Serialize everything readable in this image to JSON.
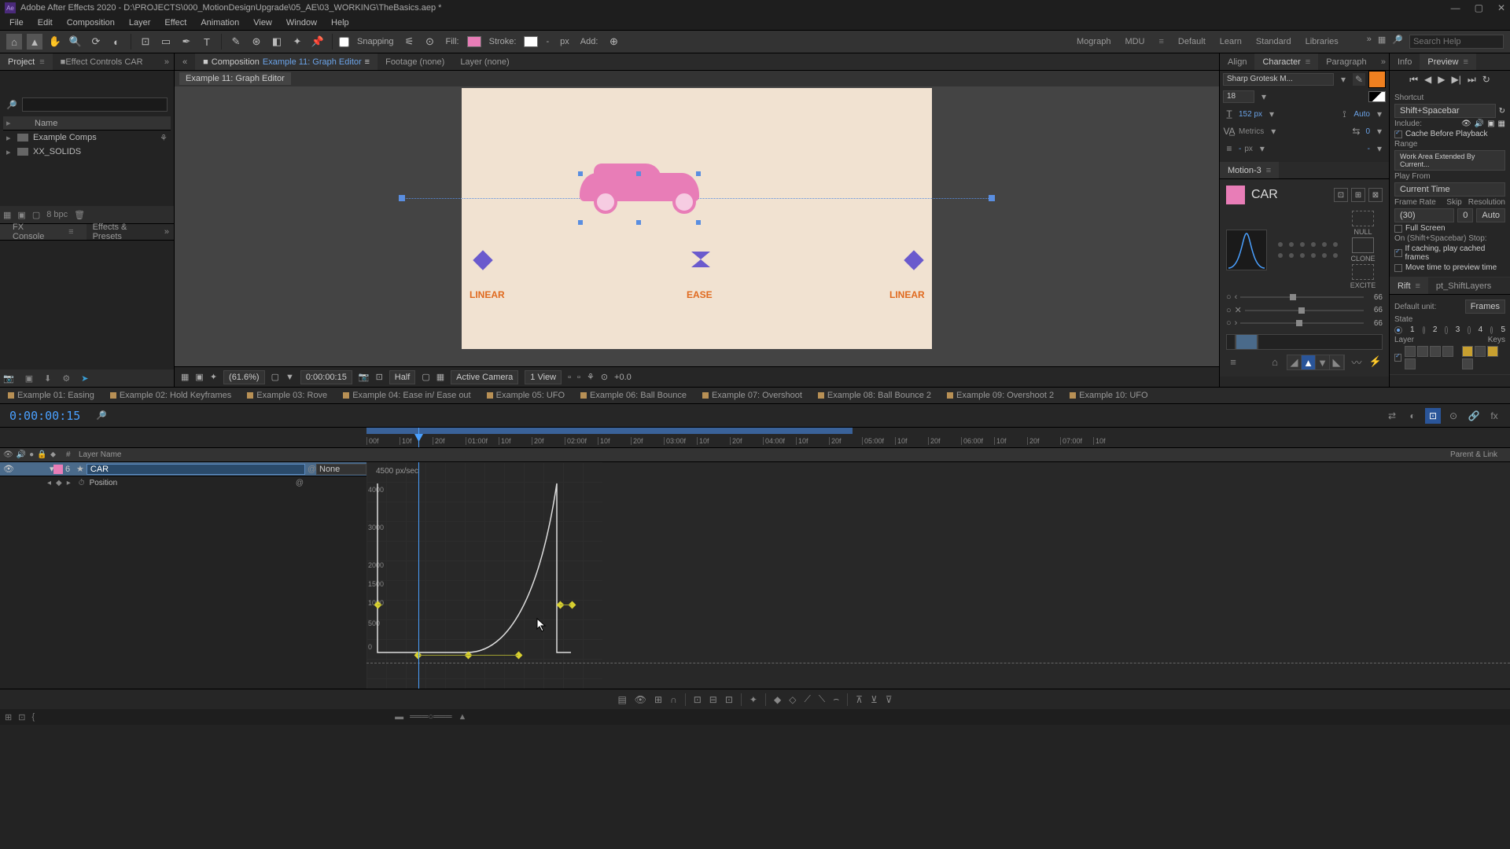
{
  "titlebar": {
    "app": "Adobe After Effects 2020",
    "path": "D:\\PROJECTS\\000_MotionDesignUpgrade\\05_AE\\03_WORKING\\TheBasics.aep *"
  },
  "menus": [
    "File",
    "Edit",
    "Composition",
    "Layer",
    "Effect",
    "Animation",
    "View",
    "Window",
    "Help"
  ],
  "toolbar": {
    "snapping": "Snapping",
    "fill": "Fill:",
    "stroke": "Stroke:",
    "strokeVal": "-",
    "px": "px",
    "add": "Add:"
  },
  "workspaces": [
    "Mograph",
    "MDU",
    "Default",
    "Learn",
    "Standard",
    "Libraries"
  ],
  "search_placeholder": "Search Help",
  "leftTabs": {
    "project": "Project",
    "ec": "Effect Controls CAR"
  },
  "project": {
    "nameHeader": "Name",
    "items": [
      {
        "label": "Example Comps"
      },
      {
        "label": "XX_SOLIDS"
      }
    ],
    "bpc": "8 bpc"
  },
  "fxconsole": "FX Console",
  "effectsPresets": "Effects & Presets",
  "compTabs": {
    "composition": "Composition",
    "compname": "Example 11: Graph Editor",
    "footage": "Footage (none)",
    "layer": "Layer (none)"
  },
  "subtab": "Example 11: Graph Editor",
  "canvas": {
    "linear": "LINEAR",
    "ease": "EASE"
  },
  "viewerFooter": {
    "zoom": "(61.6%)",
    "time": "0:00:00:15",
    "res": "Half",
    "camera": "Active Camera",
    "view": "1 View",
    "exp": "+0.0"
  },
  "rightTabs": [
    "Align",
    "Character",
    "Paragraph"
  ],
  "character": {
    "font": "Sharp Grotesk M...",
    "size": "18",
    "sizePx": "152 px",
    "metrics": "Metrics",
    "leading": "Auto",
    "tracking": "0",
    "scale": "-",
    "unit": "px",
    "scale2": "-"
  },
  "motion3": {
    "title": "Motion-3",
    "layer": "CAR",
    "null": "NULL",
    "clone": "CLONE",
    "excite": "EXCITE",
    "sliderVals": [
      "66",
      "66",
      "66"
    ]
  },
  "farRightTabs": [
    "Info",
    "Preview"
  ],
  "preview": {
    "shortcut": "Shortcut",
    "shortcutVal": "Shift+Spacebar",
    "include": "Include:",
    "cacheBefore": "Cache Before Playback",
    "range": "Range",
    "rangeVal": "Work Area Extended By Current...",
    "playFrom": "Play From",
    "playFromVal": "Current Time",
    "frameRate": "Frame Rate",
    "skip": "Skip",
    "resolution": "Resolution",
    "fr": "(30)",
    "skipVal": "0",
    "resVal": "Auto",
    "fullScreen": "Full Screen",
    "onStop": "On (Shift+Spacebar) Stop:",
    "ifCaching": "If caching, play cached frames",
    "moveTime": "Move time to preview time"
  },
  "rift": {
    "tab1": "Rift",
    "tab2": "pt_ShiftLayers",
    "defaultUnit": "Default unit:",
    "defaultVal": "Frames",
    "state": "State",
    "layer": "Layer",
    "keys": "Keys"
  },
  "timelineTabs": [
    "Example 01: Easing",
    "Example 02: Hold Keyframes",
    "Example 03: Rove",
    "Example 04: Ease in/ Ease out",
    "Example 05: UFO",
    "Example 06: Ball Bounce",
    "Example 07: Overshoot",
    "Example 08: Ball Bounce 2",
    "Example 09: Overshoot 2",
    "Example 10: UFO"
  ],
  "timecode": "0:00:00:15",
  "layerHeader": {
    "num": "#",
    "layerName": "Layer Name",
    "parent": "Parent & Link"
  },
  "layer": {
    "num": "6",
    "name": "CAR",
    "parent": "None",
    "prop": "Position"
  },
  "ruler": [
    "00f",
    "10f",
    "20f",
    "01:00f",
    "10f",
    "20f",
    "02:00f",
    "10f",
    "20f",
    "03:00f",
    "10f",
    "20f",
    "04:00f",
    "10f",
    "20f",
    "05:00f",
    "10f",
    "20f",
    "06:00f",
    "10f",
    "20f",
    "07:00f",
    "10f"
  ],
  "graph": {
    "speedLabel": "4500 px/sec",
    "yticks": [
      "4000",
      "3000",
      "2000",
      "1500",
      "1000",
      "500",
      "0"
    ]
  }
}
